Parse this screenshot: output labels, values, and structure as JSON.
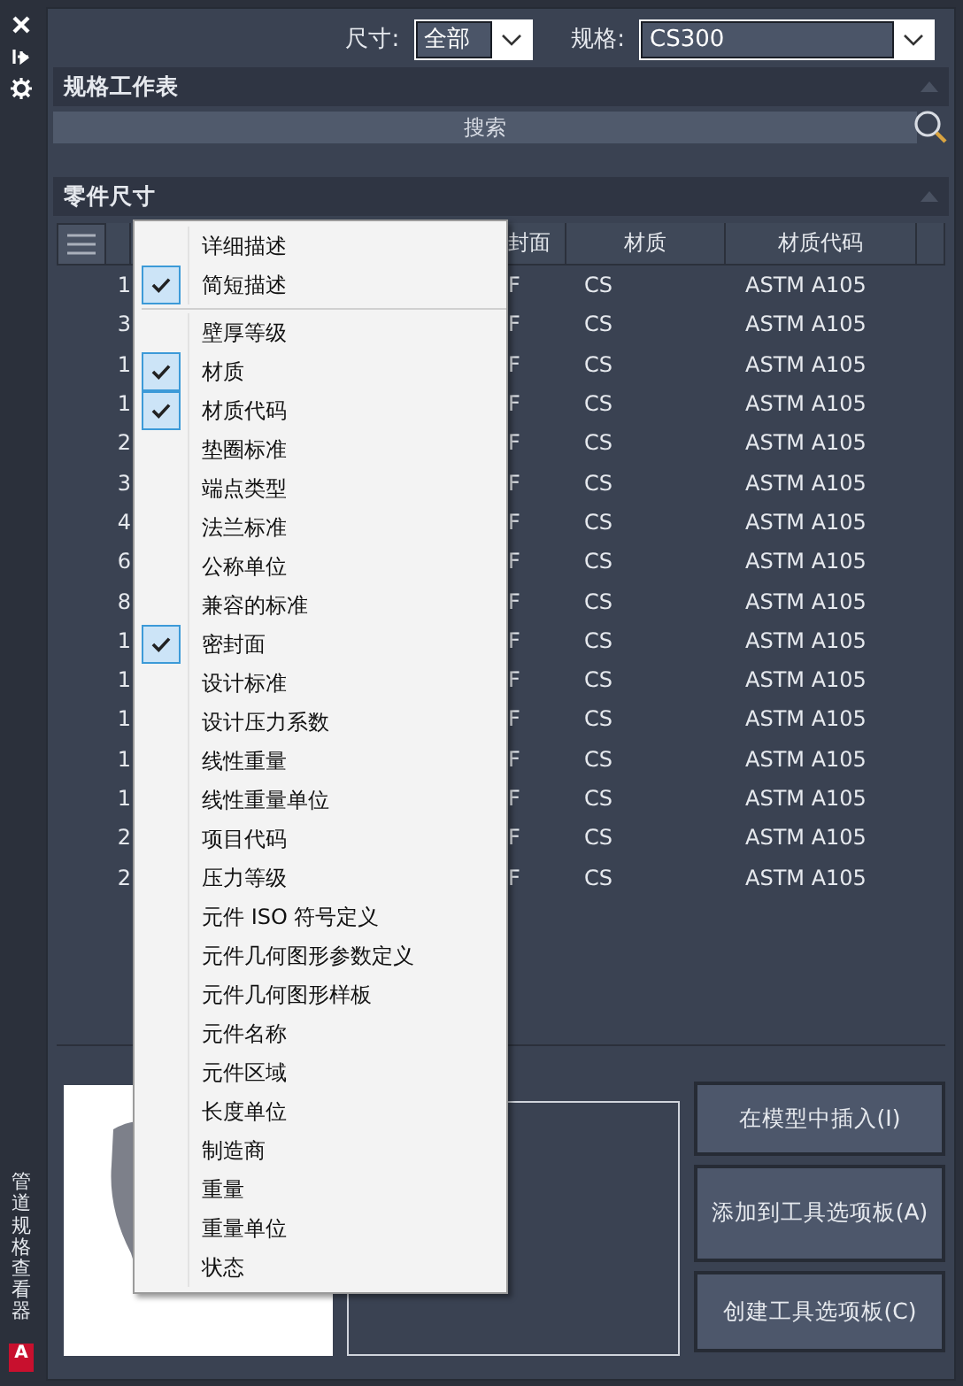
{
  "sidebar": {
    "title": "管道规格查看器",
    "logo": "A"
  },
  "filters": [
    {
      "label": "尺寸:",
      "value": "全部"
    },
    {
      "label": "规格:",
      "value": "CS300"
    }
  ],
  "spec_sheet": {
    "title": "规格工作表",
    "search": "搜索"
  },
  "parts": {
    "title": "零件尺寸",
    "columns": [
      "封面",
      "材质",
      "材质代码"
    ],
    "rows": [
      {
        "size": "1",
        "face": "F",
        "material": "CS",
        "code": "ASTM A105"
      },
      {
        "size": "3",
        "face": "F",
        "material": "CS",
        "code": "ASTM A105"
      },
      {
        "size": "1",
        "face": "F",
        "material": "CS",
        "code": "ASTM A105"
      },
      {
        "size": "1",
        "face": "F",
        "material": "CS",
        "code": "ASTM A105"
      },
      {
        "size": "2",
        "face": "F",
        "material": "CS",
        "code": "ASTM A105"
      },
      {
        "size": "3",
        "face": "F",
        "material": "CS",
        "code": "ASTM A105"
      },
      {
        "size": "4",
        "face": "F",
        "material": "CS",
        "code": "ASTM A105"
      },
      {
        "size": "6",
        "face": "F",
        "material": "CS",
        "code": "ASTM A105"
      },
      {
        "size": "8",
        "face": "F",
        "material": "CS",
        "code": "ASTM A105"
      },
      {
        "size": "1",
        "face": "F",
        "material": "CS",
        "code": "ASTM A105"
      },
      {
        "size": "1",
        "face": "F",
        "material": "CS",
        "code": "ASTM A105"
      },
      {
        "size": "1",
        "face": "F",
        "material": "CS",
        "code": "ASTM A105"
      },
      {
        "size": "1",
        "face": "F",
        "material": "CS",
        "code": "ASTM A105"
      },
      {
        "size": "1",
        "face": "F",
        "material": "CS",
        "code": "ASTM A105"
      },
      {
        "size": "2",
        "face": "F",
        "material": "CS",
        "code": "ASTM A105"
      },
      {
        "size": "2",
        "face": "F",
        "material": "CS",
        "code": "ASTM A105"
      }
    ]
  },
  "column_menu": {
    "groups": [
      [
        {
          "label": "详细描述",
          "checked": false
        },
        {
          "label": "简短描述",
          "checked": true
        }
      ],
      [
        {
          "label": "壁厚等级",
          "checked": false
        },
        {
          "label": "材质",
          "checked": true
        },
        {
          "label": "材质代码",
          "checked": true
        },
        {
          "label": "垫圈标准",
          "checked": false
        },
        {
          "label": "端点类型",
          "checked": false
        },
        {
          "label": "法兰标准",
          "checked": false
        },
        {
          "label": "公称单位",
          "checked": false
        },
        {
          "label": "兼容的标准",
          "checked": false
        },
        {
          "label": "密封面",
          "checked": true
        },
        {
          "label": "设计标准",
          "checked": false
        },
        {
          "label": "设计压力系数",
          "checked": false
        },
        {
          "label": "线性重量",
          "checked": false
        },
        {
          "label": "线性重量单位",
          "checked": false
        },
        {
          "label": "项目代码",
          "checked": false
        },
        {
          "label": "压力等级",
          "checked": false
        },
        {
          "label": "元件 ISO 符号定义",
          "checked": false
        },
        {
          "label": "元件几何图形参数定义",
          "checked": false
        },
        {
          "label": "元件几何图形样板",
          "checked": false
        },
        {
          "label": "元件名称",
          "checked": false
        },
        {
          "label": "元件区域",
          "checked": false
        },
        {
          "label": "长度单位",
          "checked": false
        },
        {
          "label": "制造商",
          "checked": false
        },
        {
          "label": "重量",
          "checked": false
        },
        {
          "label": "重量单位",
          "checked": false
        },
        {
          "label": "状态",
          "checked": false
        }
      ]
    ]
  },
  "buttons": [
    "在模型中插入(I)",
    "添加到工具选项板(A)",
    "创建工具选项板(C)"
  ]
}
